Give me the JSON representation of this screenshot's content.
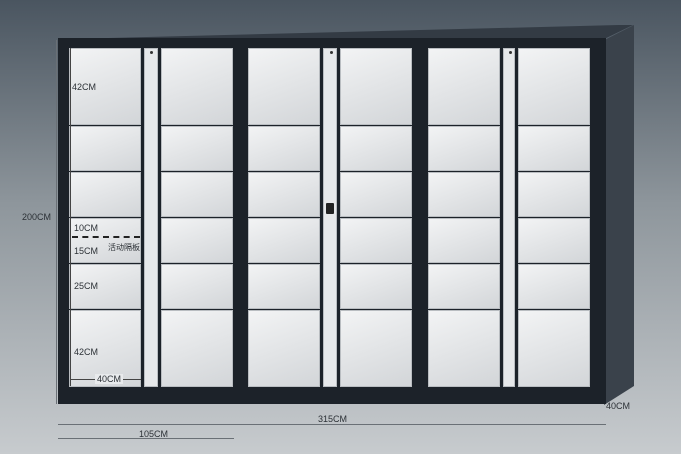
{
  "dimensions": {
    "height_label": "200CM",
    "width_label": "315CM",
    "depth_label": "40CM",
    "section_label": "105CM",
    "inner_depth_label": "40CM"
  },
  "compartments": {
    "c1": "42CM",
    "c2": "10CM",
    "c3": "15CM",
    "c4": "25CM",
    "c5": "42CM",
    "partition_label": "活动隔板"
  },
  "colors": {
    "cabinet": "#1c2229",
    "door": "#e8eaec",
    "background_top": "#4a5560",
    "background_bottom": "#c7cbce"
  }
}
